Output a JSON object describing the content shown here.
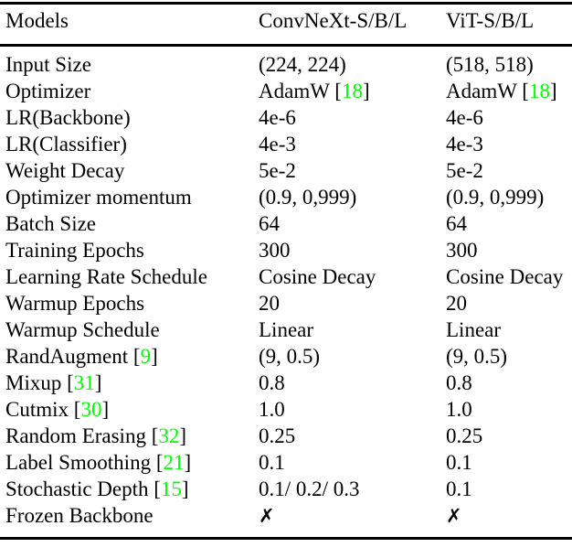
{
  "table": {
    "columns": [
      {
        "key": "models",
        "label": "Models"
      },
      {
        "key": "convnext",
        "label": "ConvNeXt-S/B/L"
      },
      {
        "key": "vit",
        "label": "ViT-S/B/L"
      }
    ],
    "rows": [
      {
        "label": "Input Size",
        "cite": null,
        "convnext": "(224, 224)",
        "vit": "(518, 518)"
      },
      {
        "label": "Optimizer",
        "cite": null,
        "convnext": "AdamW",
        "convnext_cite": "18",
        "vit": "AdamW",
        "vit_cite": "18"
      },
      {
        "label": "LR(Backbone)",
        "cite": null,
        "convnext": "4e-6",
        "vit": "4e-6"
      },
      {
        "label": "LR(Classifier)",
        "cite": null,
        "convnext": "4e-3",
        "vit": "4e-3"
      },
      {
        "label": "Weight Decay",
        "cite": null,
        "convnext": "5e-2",
        "vit": "5e-2"
      },
      {
        "label": "Optimizer momentum",
        "cite": null,
        "convnext": "(0.9, 0,999)",
        "vit": "(0.9, 0,999)"
      },
      {
        "label": "Batch Size",
        "cite": null,
        "convnext": "64",
        "vit": "64"
      },
      {
        "label": "Training Epochs",
        "cite": null,
        "convnext": "300",
        "vit": "300"
      },
      {
        "label": "Learning Rate Schedule",
        "cite": null,
        "convnext": "Cosine Decay",
        "vit": "Cosine Decay"
      },
      {
        "label": "Warmup Epochs",
        "cite": null,
        "convnext": "20",
        "vit": "20"
      },
      {
        "label": "Warmup Schedule",
        "cite": null,
        "convnext": "Linear",
        "vit": "Linear"
      },
      {
        "label": "RandAugment",
        "cite": "9",
        "convnext": "(9, 0.5)",
        "vit": "(9, 0.5)"
      },
      {
        "label": "Mixup",
        "cite": "31",
        "convnext": "0.8",
        "vit": "0.8"
      },
      {
        "label": "Cutmix",
        "cite": "30",
        "convnext": "1.0",
        "vit": "1.0"
      },
      {
        "label": "Random Erasing",
        "cite": "32",
        "convnext": "0.25",
        "vit": "0.25"
      },
      {
        "label": "Label Smoothing",
        "cite": "21",
        "convnext": "0.1",
        "vit": "0.1"
      },
      {
        "label": "Stochastic Depth",
        "cite": "15",
        "convnext": "0.1/ 0.2/ 0.3",
        "vit": "0.1"
      },
      {
        "label": "Frozen Backbone",
        "cite": null,
        "convnext": "✗",
        "vit": "✗",
        "glyph": true
      }
    ],
    "colors": {
      "text": "#000000",
      "citation": "#00ff00",
      "rule": "#000000",
      "background": "#ffffff"
    }
  }
}
